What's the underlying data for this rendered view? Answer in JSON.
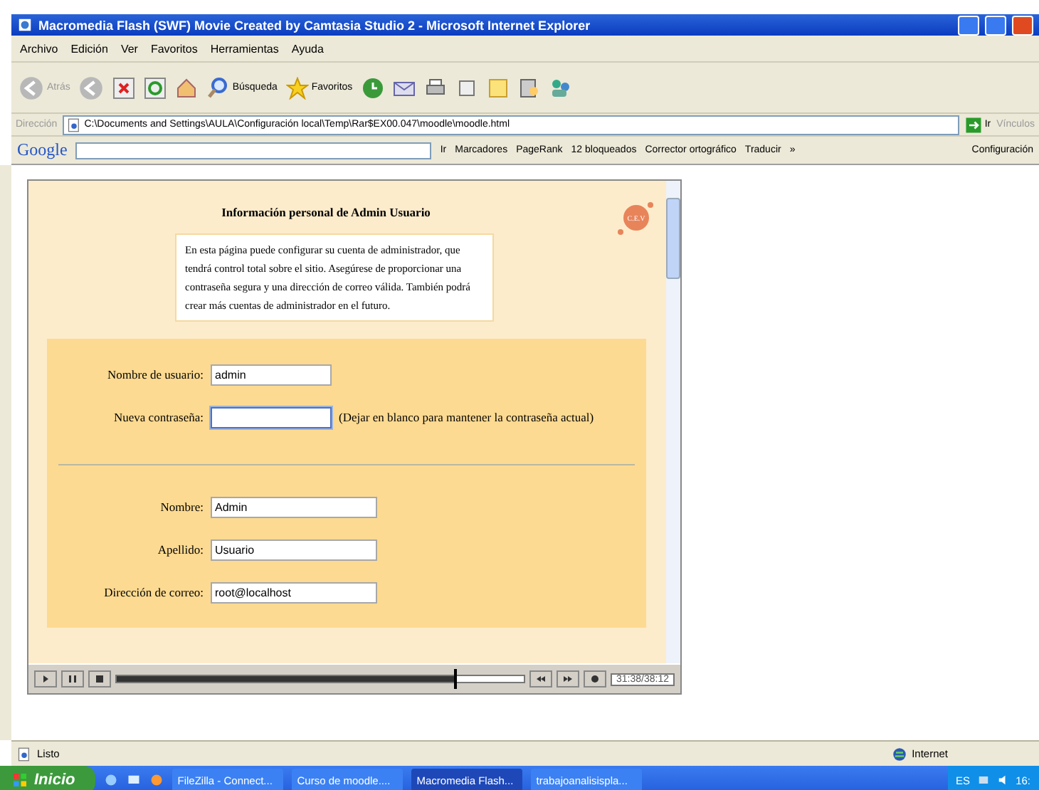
{
  "window": {
    "title": "Macromedia Flash (SWF) Movie Created by Camtasia Studio 2 - Microsoft Internet Explorer"
  },
  "menu": [
    "Archivo",
    "Edición",
    "Ver",
    "Favoritos",
    "Herramientas",
    "Ayuda"
  ],
  "toolbar": {
    "back": "Atrás",
    "search": "Búsqueda",
    "favorites": "Favoritos"
  },
  "address_bar": {
    "label": "Dirección",
    "value": "C:\\Documents and Settings\\AULA\\Configuración local\\Temp\\Rar$EX00.047\\moodle\\moodle.html",
    "go": "Ir",
    "links": "Vínculos"
  },
  "google_bar": {
    "logo": "Google",
    "go": "Ir",
    "bookmarks": "Marcadores",
    "pagerank": "PageRank",
    "blocked": "12 bloqueados",
    "spell": "Corrector ortográfico",
    "translate": "Traducir",
    "more": "»",
    "settings": "Configuración"
  },
  "movie": {
    "heading": "Información personal de Admin Usuario",
    "badge": "C.E.V",
    "intro": "En esta página puede configurar su cuenta de administrador, que tendrá control total sobre el sitio. Asegúrese de proporcionar una contraseña segura y una dirección de correo válida. También podrá crear más cuentas de administrador en el futuro.",
    "sections": [
      {
        "fields": [
          {
            "label": "Nombre de usuario:",
            "value": "admin",
            "kind": "short",
            "focused": false
          },
          {
            "label": "Nueva contraseña:",
            "kind": "short",
            "hint": "(Dejar en blanco para mantener la contraseña actual)",
            "focused": true
          }
        ]
      },
      {
        "fields": [
          {
            "label": "Nombre:",
            "value": "Admin",
            "kind": "long",
            "focused": false
          },
          {
            "label": "Apellido:",
            "value": "Usuario",
            "kind": "long",
            "focused": false
          },
          {
            "label": "Dirección de correo:",
            "value": "root@localhost",
            "kind": "long",
            "focused": false
          }
        ]
      }
    ],
    "player": {
      "level": 0.83,
      "time": "31:38/38:12"
    }
  },
  "status_bar": {
    "text": "Listo",
    "zone": "Internet"
  },
  "taskbar": {
    "start": "Inicio",
    "tasks": [
      {
        "label": "FileZilla - Connect...",
        "selected": false
      },
      {
        "label": "Curso de moodle....",
        "selected": false
      },
      {
        "label": "Macromedia Flash...",
        "selected": true
      },
      {
        "label": "trabajoanalisispla...",
        "selected": false
      }
    ],
    "lang": "ES",
    "clock": "16:"
  }
}
